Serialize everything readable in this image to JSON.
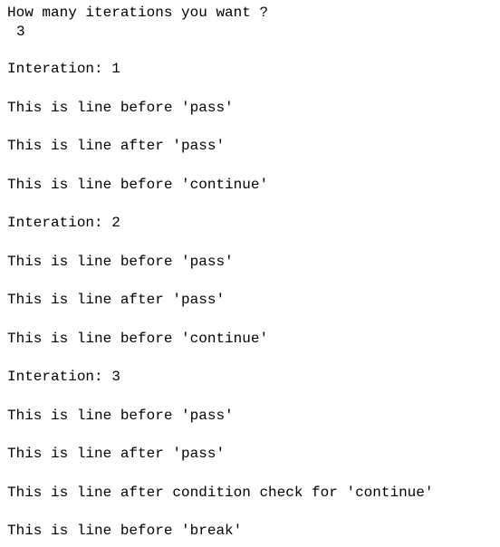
{
  "console": {
    "lines": [
      "How many iterations you want ?",
      "3",
      "Interation: 1",
      "This is line before 'pass'",
      "This is line after 'pass'",
      "This is line before 'continue'",
      "Interation: 2",
      "This is line before 'pass'",
      "This is line after 'pass'",
      "This is line before 'continue'",
      "Interation: 3",
      "This is line before 'pass'",
      "This is line after 'pass'",
      "This is line after condition check for 'continue'",
      "This is line before 'break'"
    ]
  }
}
